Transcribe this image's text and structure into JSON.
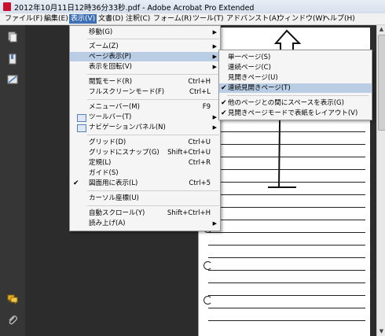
{
  "window": {
    "title": "2012年10月11日12時36分33秒.pdf - Adobe Acrobat Pro Extended"
  },
  "menubar": [
    {
      "label": "ファイル(F)"
    },
    {
      "label": "編集(E)"
    },
    {
      "label": "表示(V)"
    },
    {
      "label": "文書(D)"
    },
    {
      "label": "注釈(C)"
    },
    {
      "label": "フォーム(R)"
    },
    {
      "label": "ツール(T)"
    },
    {
      "label": "アドバンスト(A)"
    },
    {
      "label": "ウィンドウ(W)"
    },
    {
      "label": "ヘルプ(H)"
    }
  ],
  "view_menu": {
    "items": [
      {
        "label": "移動(G)",
        "shortcut": "",
        "submenu": "▶"
      },
      {
        "label": "ズーム(Z)",
        "shortcut": "",
        "submenu": "▶"
      },
      {
        "label": "ページ表示(P)",
        "shortcut": "",
        "submenu": "▶"
      },
      {
        "label": "表示を回転(V)",
        "shortcut": "",
        "submenu": "▶"
      },
      {
        "label": "閲覧モード(R)",
        "shortcut": "Ctrl+H",
        "submenu": ""
      },
      {
        "label": "フルスクリーンモード(F)",
        "shortcut": "Ctrl+L",
        "submenu": ""
      },
      {
        "label": "メニューバー(M)",
        "shortcut": "F9",
        "submenu": ""
      },
      {
        "label": "ツールバー(T)",
        "shortcut": "",
        "submenu": "▶"
      },
      {
        "label": "ナビゲーションパネル(N)",
        "shortcut": "",
        "submenu": "▶"
      },
      {
        "label": "グリッド(D)",
        "shortcut": "Ctrl+U",
        "submenu": ""
      },
      {
        "label": "グリッドにスナップ(G)",
        "shortcut": "Shift+Ctrl+U",
        "submenu": ""
      },
      {
        "label": "定規(L)",
        "shortcut": "Ctrl+R",
        "submenu": ""
      },
      {
        "label": "ガイド(S)",
        "shortcut": "",
        "submenu": ""
      },
      {
        "label": "図面用に表示(L)",
        "shortcut": "Ctrl+5",
        "submenu": ""
      },
      {
        "label": "カーソル座標(U)",
        "shortcut": "",
        "submenu": ""
      },
      {
        "label": "自動スクロール(Y)",
        "shortcut": "Shift+Ctrl+H",
        "submenu": ""
      },
      {
        "label": "読み上げ(A)",
        "shortcut": "",
        "submenu": "▶"
      }
    ],
    "checked_mark": "✔"
  },
  "page_display_submenu": {
    "items": [
      {
        "label": "単一ページ(S)"
      },
      {
        "label": "連続ページ(C)"
      },
      {
        "label": "見開きページ(U)"
      },
      {
        "label": "連続見開きページ(T)"
      },
      {
        "label": "他のページとの間にスペースを表示(G)"
      },
      {
        "label": "見開きページモードで表紙をレイアウト(V)"
      }
    ],
    "checked_mark": "✔"
  },
  "scrollbar": {
    "up_arrow": "▲",
    "down_arrow": "▼"
  },
  "colors": {
    "menu_highlight": "#b9cde4",
    "menubar_active": "#3d6fb5",
    "workspace": "#2c2c2c"
  }
}
